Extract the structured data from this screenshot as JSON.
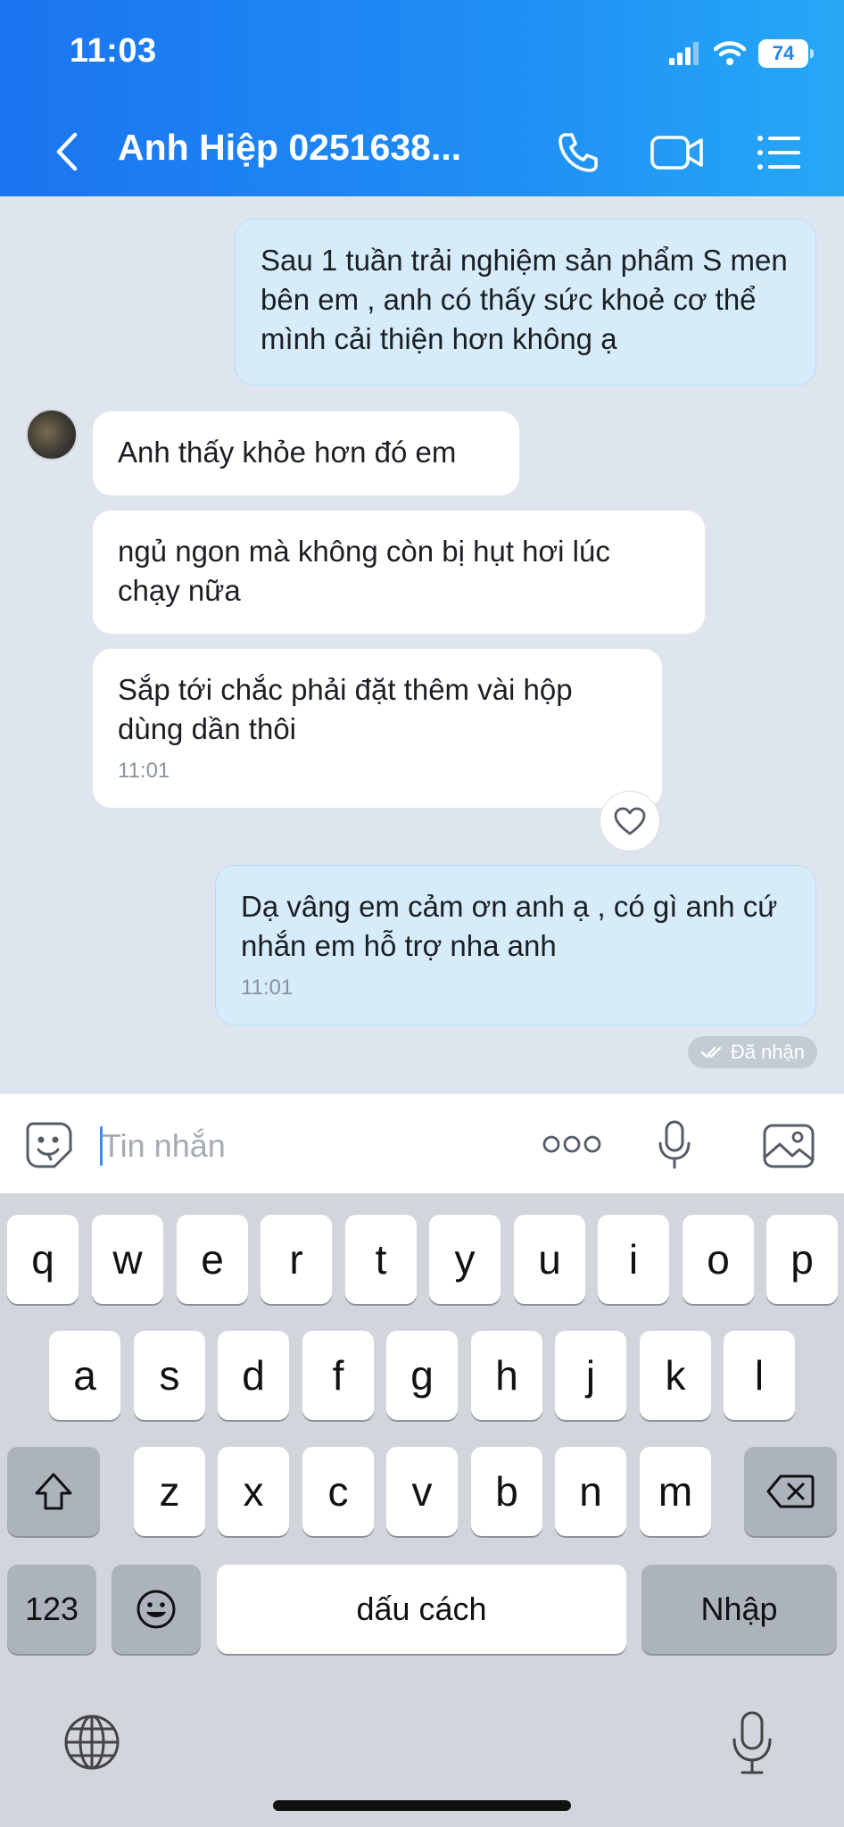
{
  "status_bar": {
    "time": "11:03",
    "battery": "74"
  },
  "header": {
    "contact_name": "Anh Hiệp 0251638...",
    "icons": [
      "back-icon",
      "phone-icon",
      "video-call-icon",
      "menu-icon"
    ]
  },
  "messages": [
    {
      "direction": "out",
      "text": "Sau 1 tuần trải nghiệm sản phẩm S men bên em , anh có thấy sức khoẻ cơ thể mình cải thiện hơn không ạ"
    },
    {
      "direction": "in",
      "text": "Anh thấy khỏe hơn đó em"
    },
    {
      "direction": "in",
      "text": "ngủ ngon mà không còn bị hụt hơi lúc chạy nữa"
    },
    {
      "direction": "in",
      "text": "Sắp tới chắc phải đặt thêm vài hộp dùng dần thôi",
      "time": "11:01"
    },
    {
      "direction": "out",
      "text": "Dạ vâng em cảm ơn anh ạ , có gì anh cứ nhắn em hỗ trợ nha anh",
      "time": "11:01"
    }
  ],
  "received_status": "Đã nhận",
  "input": {
    "placeholder": "Tin nhắn",
    "more": "ooo"
  },
  "keyboard": {
    "row1": [
      "q",
      "w",
      "e",
      "r",
      "t",
      "y",
      "u",
      "i",
      "o",
      "p"
    ],
    "row2": [
      "a",
      "s",
      "d",
      "f",
      "g",
      "h",
      "j",
      "k",
      "l"
    ],
    "row3": [
      "z",
      "x",
      "c",
      "v",
      "b",
      "n",
      "m"
    ],
    "numbers_key": "123",
    "space_key": "dấu cách",
    "return_key": "Nhập"
  },
  "colors": {
    "header_start": "#1b74f0",
    "header_end": "#26a8f6",
    "outgoing_bubble": "#d6ecfb",
    "incoming_bubble": "#ffffff",
    "chat_bg": "#dfe5ee"
  }
}
